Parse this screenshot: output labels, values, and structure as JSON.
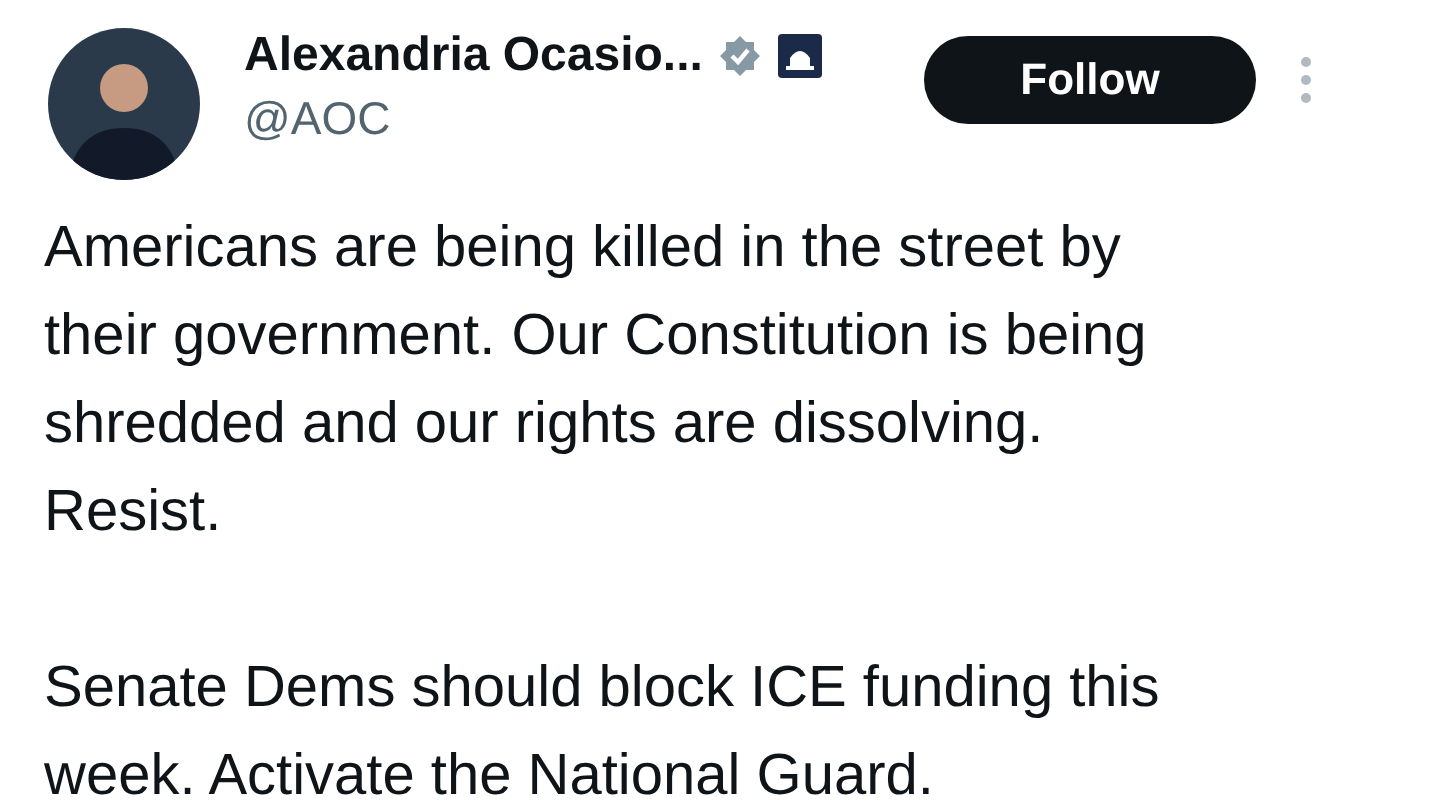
{
  "author": {
    "name": "Alexandria Ocasio...",
    "handle": "@AOC",
    "verified": true,
    "affiliate_badge": true
  },
  "follow_button": {
    "label": "Follow"
  },
  "paragraphs": [
    {
      "lines": [
        "Americans are being killed in the street by",
        "their government. Our Constitution is being",
        "shredded and our rights are dissolving.",
        "Resist."
      ]
    },
    {
      "lines": [
        "Senate Dems should block ICE funding this",
        "week. Activate the National Guard."
      ]
    }
  ]
}
